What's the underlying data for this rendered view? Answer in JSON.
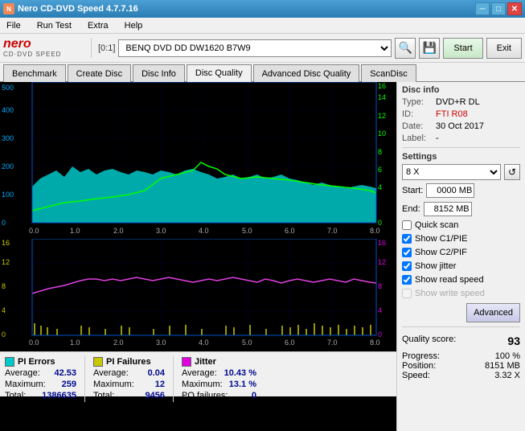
{
  "app": {
    "title": "Nero CD-DVD Speed 4.7.7.16",
    "icon": "●"
  },
  "titlebar": {
    "title": "Nero CD-DVD Speed 4.7.7.16",
    "min_label": "─",
    "max_label": "□",
    "close_label": "✕"
  },
  "menu": {
    "items": [
      "File",
      "Run Test",
      "Extra",
      "Help"
    ]
  },
  "toolbar": {
    "nero_logo": "nero",
    "nero_sub": "CD·DVD SPEED",
    "drive_label": "[0:1]",
    "drive_value": "BENQ DVD DD DW1620 B7W9",
    "start_label": "Start",
    "exit_label": "Exit"
  },
  "tabs": [
    {
      "label": "Benchmark",
      "active": false
    },
    {
      "label": "Create Disc",
      "active": false
    },
    {
      "label": "Disc Info",
      "active": false
    },
    {
      "label": "Disc Quality",
      "active": true
    },
    {
      "label": "Advanced Disc Quality",
      "active": false
    },
    {
      "label": "ScanDisc",
      "active": false
    }
  ],
  "disc_info": {
    "title": "Disc info",
    "type_label": "Type:",
    "type_value": "DVD+R DL",
    "id_label": "ID:",
    "id_value": "FTI R08",
    "date_label": "Date:",
    "date_value": "30 Oct 2017",
    "label_label": "Label:",
    "label_value": "-"
  },
  "settings": {
    "title": "Settings",
    "speed_value": "8 X",
    "start_label": "Start:",
    "start_value": "0000 MB",
    "end_label": "End:",
    "end_value": "8152 MB",
    "quick_scan_label": "Quick scan",
    "c1pie_label": "Show C1/PIE",
    "c2pif_label": "Show C2/PIF",
    "jitter_label": "Show jitter",
    "read_speed_label": "Show read speed",
    "write_speed_label": "Show write speed",
    "advanced_btn": "Advanced"
  },
  "quality": {
    "score_label": "Quality score:",
    "score_value": "93",
    "progress_label": "Progress:",
    "progress_value": "100 %",
    "position_label": "Position:",
    "position_value": "8151 MB",
    "speed_label": "Speed:",
    "speed_value": "3.32 X"
  },
  "stats": {
    "pi_errors": {
      "label": "PI Errors",
      "color": "#00b0e0",
      "avg_label": "Average:",
      "avg_value": "42.53",
      "max_label": "Maximum:",
      "max_value": "259",
      "total_label": "Total:",
      "total_value": "1386635"
    },
    "pi_failures": {
      "label": "PI Failures",
      "color": "#c8c800",
      "avg_label": "Average:",
      "avg_value": "0.04",
      "max_label": "Maximum:",
      "max_value": "12",
      "total_label": "Total:",
      "total_value": "9456"
    },
    "jitter": {
      "label": "Jitter",
      "color": "#e000e0",
      "avg_label": "Average:",
      "avg_value": "10.43 %",
      "max_label": "Maximum:",
      "max_value": "13.1 %",
      "po_label": "PO failures:",
      "po_value": "0"
    }
  },
  "checkboxes": {
    "quick_scan": false,
    "c1pie": true,
    "c2pif": true,
    "jitter": true,
    "read_speed": true,
    "write_speed": false
  }
}
